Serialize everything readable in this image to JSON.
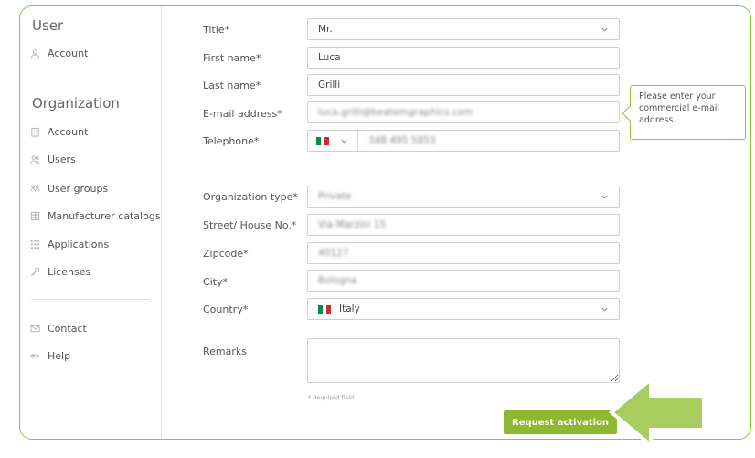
{
  "sidebar": {
    "user_title": "User",
    "user_items": [
      {
        "label": "Account",
        "icon": "user-icon"
      }
    ],
    "org_title": "Organization",
    "org_items": [
      {
        "label": "Account",
        "icon": "building-icon"
      },
      {
        "label": "Users",
        "icon": "users-icon"
      },
      {
        "label": "User groups",
        "icon": "user-groups-icon"
      },
      {
        "label": "Manufacturer catalogs",
        "icon": "catalog-icon"
      },
      {
        "label": "Applications",
        "icon": "apps-grid-icon"
      },
      {
        "label": "Licenses",
        "icon": "key-icon"
      }
    ],
    "bottom_items": [
      {
        "label": "Contact",
        "icon": "envelope-icon"
      },
      {
        "label": "Help",
        "icon": "help-icon"
      }
    ]
  },
  "form": {
    "title": {
      "label": "Title*",
      "value": "Mr."
    },
    "first_name": {
      "label": "First name*",
      "value": "Luca"
    },
    "last_name": {
      "label": "Last name*",
      "value": "Grilli"
    },
    "email": {
      "label": "E-mail address*",
      "value": "luca.grilli@beatemgraphics.com"
    },
    "telephone": {
      "label": "Telephone*",
      "value": "348 495 5853"
    },
    "org_type": {
      "label": "Organization type*",
      "value": "Private"
    },
    "street": {
      "label": "Street/ House No.*",
      "value": "Via Marzini 15"
    },
    "zipcode": {
      "label": "Zipcode*",
      "value": "40127"
    },
    "city": {
      "label": "City*",
      "value": "Bologna"
    },
    "country": {
      "label": "Country*",
      "value": "Italy"
    },
    "remarks": {
      "label": "Remarks",
      "value": ""
    },
    "required_note": "* Required field",
    "submit_label": "Request activation"
  },
  "tooltip": {
    "text": "Please enter your commercial e-mail address."
  },
  "colors": {
    "accent": "#8cc63f",
    "button": "#8cb92f",
    "flag_green": "#009246",
    "flag_white": "#ffffff",
    "flag_red": "#ce2b37"
  }
}
